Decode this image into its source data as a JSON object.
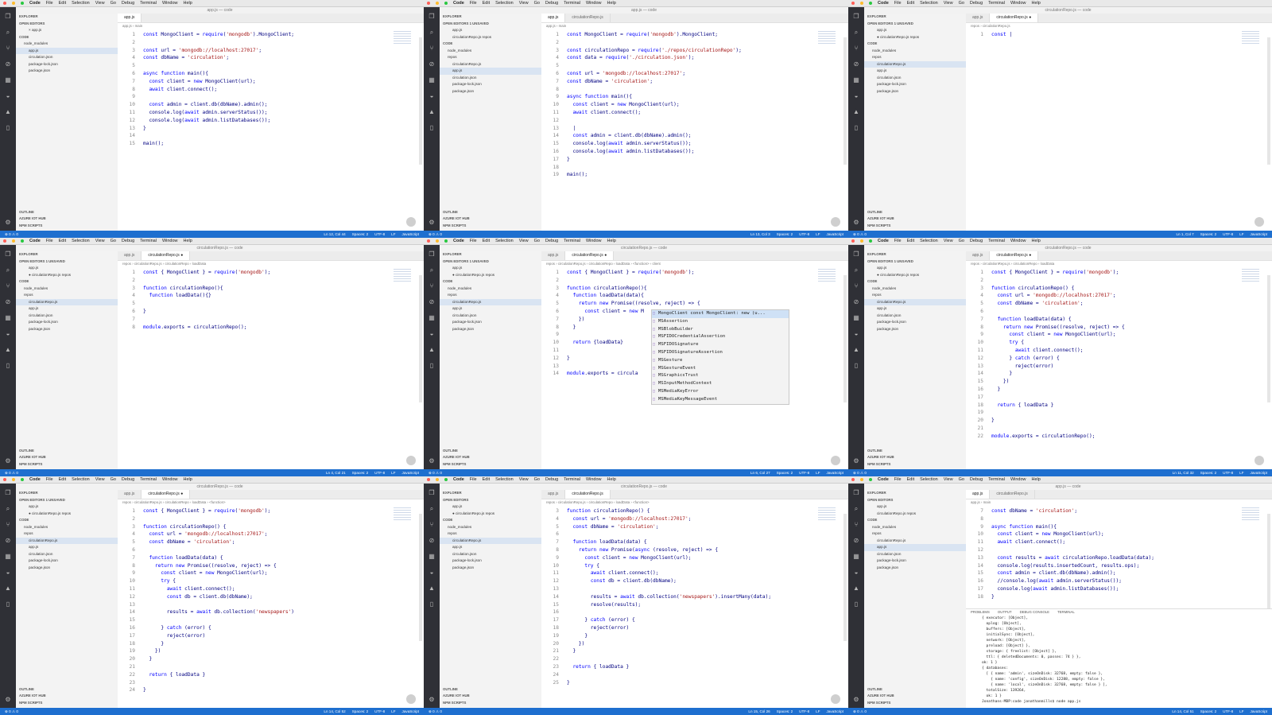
{
  "menubar": {
    "app": "Code",
    "items": [
      "File",
      "Edit",
      "Selection",
      "View",
      "Go",
      "Debug",
      "Terminal",
      "Window",
      "Help"
    ]
  },
  "colors": {
    "status_bar": "#1e6fcf",
    "keyword": "#0000ff",
    "string": "#a31515",
    "sidebar": "#f3f3f3"
  },
  "panels": [
    {
      "title": "app.js — code",
      "sidebar": [
        "EXPLORER",
        "OPEN EDITORS",
        "× app.js",
        "CODE",
        "node_modules",
        "app.js",
        "circulation.json",
        "package-lock.json",
        "package.json"
      ],
      "sidebar_bottom": [
        "OUTLINE",
        "AZURE IOT HUB",
        "NPM SCRIPTS"
      ],
      "tabs": [
        "app.js"
      ],
      "active_tab": 0,
      "breadcrumb": "app.js › main",
      "lines": [
        {
          "n": "1",
          "t": "const MongoClient = require('mongodb').MongoClient;"
        },
        {
          "n": "2",
          "t": ""
        },
        {
          "n": "3",
          "t": "const url = 'mongodb://localhost:27017';"
        },
        {
          "n": "4",
          "t": "const dbName = 'circulation';"
        },
        {
          "n": "5",
          "t": ""
        },
        {
          "n": "6",
          "t": "async function main(){"
        },
        {
          "n": "7",
          "t": "  const client = new MongoClient(url);"
        },
        {
          "n": "8",
          "t": "  await client.connect();"
        },
        {
          "n": "9",
          "t": ""
        },
        {
          "n": "10",
          "t": "  const admin = client.db(dbName).admin();"
        },
        {
          "n": "11",
          "t": "  console.log(await admin.serverStatus());"
        },
        {
          "n": "12",
          "t": "  console.log(await admin.listDatabases());"
        },
        {
          "n": "13",
          "t": "}"
        },
        {
          "n": "14",
          "t": ""
        },
        {
          "n": "15",
          "t": "main();"
        }
      ],
      "status": [
        "Ln 12, Col 44",
        "Spaces: 2",
        "UTF-8",
        "LF",
        "JavaScript"
      ]
    },
    {
      "title": "app.js — code",
      "sidebar": [
        "EXPLORER",
        "OPEN EDITORS  1 UNSAVED",
        "app.js",
        "circulationRepo.js repos",
        "CODE",
        "node_modules",
        "repos",
        "circulationRepo.js",
        "app.js",
        "circulation.json",
        "package-lock.json",
        "package.json"
      ],
      "sidebar_bottom": [
        "OUTLINE",
        "AZURE IOT HUB",
        "NPM SCRIPTS"
      ],
      "tabs": [
        "app.js",
        "circulationRepo.js"
      ],
      "active_tab": 0,
      "breadcrumb": "app.js › main",
      "lines": [
        {
          "n": "1",
          "t": "const MongoClient = require('mongodb').MongoClient;"
        },
        {
          "n": "2",
          "t": ""
        },
        {
          "n": "3",
          "t": "const circulationRepo = require('./repos/circulationRepo');"
        },
        {
          "n": "4",
          "t": "const data = require('./circulation.json');"
        },
        {
          "n": "5",
          "t": ""
        },
        {
          "n": "6",
          "t": "const url = 'mongodb://localhost:27017';"
        },
        {
          "n": "7",
          "t": "const dbName = 'circulation';"
        },
        {
          "n": "8",
          "t": ""
        },
        {
          "n": "9",
          "t": "async function main(){"
        },
        {
          "n": "10",
          "t": "  const client = new MongoClient(url);"
        },
        {
          "n": "11",
          "t": "  await client.connect();"
        },
        {
          "n": "12",
          "t": ""
        },
        {
          "n": "13",
          "t": "  |"
        },
        {
          "n": "14",
          "t": "  const admin = client.db(dbName).admin();"
        },
        {
          "n": "15",
          "t": "  console.log(await admin.serverStatus());"
        },
        {
          "n": "16",
          "t": "  console.log(await admin.listDatabases());"
        },
        {
          "n": "17",
          "t": "}"
        },
        {
          "n": "18",
          "t": ""
        },
        {
          "n": "19",
          "t": "main();"
        }
      ],
      "status": [
        "Ln 13, Col 3",
        "Spaces: 2",
        "UTF-8",
        "LF",
        "JavaScript"
      ]
    },
    {
      "title": "circulationRepo.js — code",
      "sidebar": [
        "EXPLORER",
        "OPEN EDITORS  1 UNSAVED",
        "app.js",
        "● circulationRepo.js repos",
        "CODE",
        "node_modules",
        "repos",
        "circulationRepo.js",
        "app.js",
        "circulation.json",
        "package-lock.json",
        "package.json"
      ],
      "sidebar_bottom": [
        "OUTLINE",
        "AZURE IOT HUB",
        "NPM SCRIPTS"
      ],
      "tabs": [
        "app.js",
        "circulationRepo.js ●"
      ],
      "active_tab": 1,
      "breadcrumb": "repos › circulationRepo.js",
      "lines": [
        {
          "n": "1",
          "t": "const |"
        }
      ],
      "status": [
        "Ln 1, Col 7",
        "Spaces: 2",
        "UTF-8",
        "LF",
        "JavaScript"
      ]
    },
    {
      "title": "circulationRepo.js — code",
      "sidebar": [
        "EXPLORER",
        "OPEN EDITORS  1 UNSAVED",
        "app.js",
        "● circulationRepo.js repos",
        "CODE",
        "node_modules",
        "repos",
        "circulationRepo.js",
        "app.js",
        "circulation.json",
        "package-lock.json",
        "package.json"
      ],
      "sidebar_bottom": [
        "OUTLINE",
        "AZURE IOT HUB",
        "NPM SCRIPTS"
      ],
      "tabs": [
        "app.js",
        "circulationRepo.js ●"
      ],
      "active_tab": 1,
      "breadcrumb": "repos › circulationRepo.js › circulationRepo › loadData",
      "lines": [
        {
          "n": "1",
          "t": "const { MongoClient } = require('mongodb');"
        },
        {
          "n": "2",
          "t": ""
        },
        {
          "n": "3",
          "t": "function circulationRepo(){"
        },
        {
          "n": "4",
          "t": "  function loadData(){}"
        },
        {
          "n": "5",
          "t": ""
        },
        {
          "n": "6",
          "t": "}"
        },
        {
          "n": "7",
          "t": ""
        },
        {
          "n": "8",
          "t": "module.exports = circulationRepo();"
        }
      ],
      "status": [
        "Ln 4, Col 21",
        "Spaces: 2",
        "UTF-8",
        "LF",
        "JavaScript"
      ]
    },
    {
      "title": "circulationRepo.js — code",
      "sidebar": [
        "EXPLORER",
        "OPEN EDITORS  1 UNSAVED",
        "app.js",
        "● circulationRepo.js repos",
        "CODE",
        "node_modules",
        "repos",
        "circulationRepo.js",
        "app.js",
        "circulation.json",
        "package-lock.json",
        "package.json"
      ],
      "sidebar_bottom": [
        "OUTLINE",
        "AZURE IOT HUB",
        "NPM SCRIPTS"
      ],
      "tabs": [
        "app.js",
        "circulationRepo.js ●"
      ],
      "active_tab": 1,
      "breadcrumb": "repos › circulationRepo.js › circulationRepo › loadData › <function> › client",
      "lines": [
        {
          "n": "1",
          "t": "const { MongoClient } = require('mongodb');"
        },
        {
          "n": "2",
          "t": ""
        },
        {
          "n": "3",
          "t": "function circulationRepo(){"
        },
        {
          "n": "4",
          "t": "  function loadData(data){"
        },
        {
          "n": "5",
          "t": "    return new Promise((resolve, reject) => {"
        },
        {
          "n": "6",
          "t": "      const client = new M"
        },
        {
          "n": "7",
          "t": "    })"
        },
        {
          "n": "8",
          "t": "  }"
        },
        {
          "n": "9",
          "t": ""
        },
        {
          "n": "10",
          "t": "  return {loadData}"
        },
        {
          "n": "11",
          "t": ""
        },
        {
          "n": "12",
          "t": "}"
        },
        {
          "n": "13",
          "t": ""
        },
        {
          "n": "14",
          "t": "module.exports = circula"
        }
      ],
      "autocomplete": [
        "MongoClient  const MongoClient: new (u...",
        "MSAssertion",
        "MSBlobBuilder",
        "MSFIDOCredentialAssertion",
        "MSFIDOSignature",
        "MSFIDOSignatureAssertion",
        "MSGesture",
        "MSGestureEvent",
        "MSGraphicsTrust",
        "MSInputMethodContext",
        "MSMediaKeyError",
        "MSMediaKeyMessageEvent"
      ],
      "status": [
        "Ln 6, Col 27",
        "Spaces: 2",
        "UTF-8",
        "LF",
        "JavaScript"
      ]
    },
    {
      "title": "circulationRepo.js — code",
      "sidebar": [
        "EXPLORER",
        "OPEN EDITORS  1 UNSAVED",
        "app.js",
        "● circulationRepo.js repos",
        "CODE",
        "node_modules",
        "repos",
        "circulationRepo.js",
        "app.js",
        "circulation.json",
        "package-lock.json",
        "package.json"
      ],
      "sidebar_bottom": [
        "OUTLINE",
        "AZURE IOT HUB",
        "NPM SCRIPTS"
      ],
      "tabs": [
        "app.js",
        "circulationRepo.js ●"
      ],
      "active_tab": 1,
      "breadcrumb": "repos › circulationRepo.js › circulationRepo › loadData",
      "lines": [
        {
          "n": "1",
          "t": "const { MongoClient } = require('mongodb');"
        },
        {
          "n": "2",
          "t": ""
        },
        {
          "n": "3",
          "t": "function circulationRepo() {"
        },
        {
          "n": "4",
          "t": "  const url = 'mongodb://localhost:27017';"
        },
        {
          "n": "5",
          "t": "  const dbName = 'circulation';"
        },
        {
          "n": "6",
          "t": ""
        },
        {
          "n": "7",
          "t": "  function loadData(data) {"
        },
        {
          "n": "8",
          "t": "    return new Promise((resolve, reject) => {"
        },
        {
          "n": "9",
          "t": "      const client = new MongoClient(url);"
        },
        {
          "n": "10",
          "t": "      try {"
        },
        {
          "n": "11",
          "t": "        await client.connect();"
        },
        {
          "n": "12",
          "t": "      } catch (error) {"
        },
        {
          "n": "13",
          "t": "        reject(error)"
        },
        {
          "n": "14",
          "t": "      }"
        },
        {
          "n": "15",
          "t": "    })"
        },
        {
          "n": "16",
          "t": "  }"
        },
        {
          "n": "17",
          "t": ""
        },
        {
          "n": "18",
          "t": "  return { loadData }"
        },
        {
          "n": "19",
          "t": ""
        },
        {
          "n": "20",
          "t": "}"
        },
        {
          "n": "21",
          "t": ""
        },
        {
          "n": "22",
          "t": "module.exports = circulationRepo();"
        }
      ],
      "status": [
        "Ln 11, Col 32",
        "Spaces: 2",
        "UTF-8",
        "LF",
        "JavaScript"
      ]
    },
    {
      "title": "circulationRepo.js — code",
      "sidebar": [
        "EXPLORER",
        "OPEN EDITORS  1 UNSAVED",
        "app.js",
        "● circulationRepo.js repos",
        "CODE",
        "node_modules",
        "repos",
        "circulationRepo.js",
        "app.js",
        "circulation.json",
        "package-lock.json",
        "package.json"
      ],
      "sidebar_bottom": [
        "OUTLINE",
        "AZURE IOT HUB",
        "NPM SCRIPTS"
      ],
      "tabs": [
        "app.js",
        "circulationRepo.js ●"
      ],
      "active_tab": 1,
      "breadcrumb": "repos › circulationRepo.js › circulationRepo › loadData › <function>",
      "lines": [
        {
          "n": "1",
          "t": "const { MongoClient } = require('mongodb');"
        },
        {
          "n": "2",
          "t": ""
        },
        {
          "n": "3",
          "t": "function circulationRepo() {"
        },
        {
          "n": "4",
          "t": "  const url = 'mongodb://localhost:27017';"
        },
        {
          "n": "5",
          "t": "  const dbName = 'circulation';"
        },
        {
          "n": "6",
          "t": ""
        },
        {
          "n": "7",
          "t": "  function loadData(data) {"
        },
        {
          "n": "8",
          "t": "    return new Promise((resolve, reject) => {"
        },
        {
          "n": "9",
          "t": "      const client = new MongoClient(url);"
        },
        {
          "n": "10",
          "t": "      try {"
        },
        {
          "n": "11",
          "t": "        await client.connect();"
        },
        {
          "n": "12",
          "t": "        const db = client.db(dbName);"
        },
        {
          "n": "13",
          "t": ""
        },
        {
          "n": "14",
          "t": "        results = await db.collection('newspapers')"
        },
        {
          "n": "15",
          "t": ""
        },
        {
          "n": "16",
          "t": "      } catch (error) {"
        },
        {
          "n": "17",
          "t": "        reject(error)"
        },
        {
          "n": "18",
          "t": "      }"
        },
        {
          "n": "19",
          "t": "    })"
        },
        {
          "n": "20",
          "t": "  }"
        },
        {
          "n": "21",
          "t": ""
        },
        {
          "n": "22",
          "t": "  return { loadData }"
        },
        {
          "n": "23",
          "t": ""
        },
        {
          "n": "24",
          "t": "}"
        }
      ],
      "status": [
        "Ln 14, Col 52",
        "Spaces: 2",
        "UTF-8",
        "LF",
        "JavaScript"
      ]
    },
    {
      "title": "circulationRepo.js — code",
      "sidebar": [
        "EXPLORER",
        "OPEN EDITORS",
        "app.js",
        "● circulationRepo.js repos",
        "CODE",
        "node_modules",
        "repos",
        "circulationRepo.js",
        "app.js",
        "circulation.json",
        "package-lock.json",
        "package.json"
      ],
      "sidebar_bottom": [
        "OUTLINE",
        "AZURE IOT HUB",
        "NPM SCRIPTS"
      ],
      "tabs": [
        "app.js",
        "circulationRepo.js"
      ],
      "active_tab": 1,
      "breadcrumb": "repos › circulationRepo.js › circulationRepo › loadData › <function>",
      "lines": [
        {
          "n": "3",
          "t": "function circulationRepo() {"
        },
        {
          "n": "4",
          "t": "  const url = 'mongodb://localhost:27017';"
        },
        {
          "n": "5",
          "t": "  const dbName = 'circulation';"
        },
        {
          "n": "6",
          "t": ""
        },
        {
          "n": "7",
          "t": "  function loadData(data) {"
        },
        {
          "n": "8",
          "t": "    return new Promise(async (resolve, reject) => {"
        },
        {
          "n": "9",
          "t": "      const client = new MongoClient(url);"
        },
        {
          "n": "10",
          "t": "      try {"
        },
        {
          "n": "11",
          "t": "        await client.connect();"
        },
        {
          "n": "12",
          "t": "        const db = client.db(dbName);"
        },
        {
          "n": "13",
          "t": ""
        },
        {
          "n": "14",
          "t": "        results = await db.collection('newspapers').insertMany(data);"
        },
        {
          "n": "15",
          "t": "        resolve(results);"
        },
        {
          "n": "16",
          "t": ""
        },
        {
          "n": "17",
          "t": "      } catch (error) {"
        },
        {
          "n": "18",
          "t": "        reject(error)"
        },
        {
          "n": "19",
          "t": "      }"
        },
        {
          "n": "20",
          "t": "    })"
        },
        {
          "n": "21",
          "t": "  }"
        },
        {
          "n": "22",
          "t": ""
        },
        {
          "n": "23",
          "t": "  return { loadData }"
        },
        {
          "n": "24",
          "t": ""
        },
        {
          "n": "25",
          "t": "}"
        }
      ],
      "status": [
        "Ln 15, Col 26",
        "Spaces: 2",
        "UTF-8",
        "LF",
        "JavaScript"
      ]
    },
    {
      "title": "app.js — code",
      "sidebar": [
        "EXPLORER",
        "OPEN EDITORS",
        "app.js",
        "circulationRepo.js repos",
        "CODE",
        "node_modules",
        "repos",
        "circulationRepo.js",
        "app.js",
        "circulation.json",
        "package-lock.json",
        "package.json"
      ],
      "sidebar_bottom": [
        "OUTLINE",
        "AZURE IOT HUB",
        "NPM SCRIPTS"
      ],
      "tabs": [
        "app.js",
        "circulationRepo.js"
      ],
      "active_tab": 0,
      "breadcrumb": "app.js › main",
      "lines": [
        {
          "n": "7",
          "t": "const dbName = 'circulation';"
        },
        {
          "n": "8",
          "t": ""
        },
        {
          "n": "9",
          "t": "async function main(){"
        },
        {
          "n": "10",
          "t": "  const client = new MongoClient(url);"
        },
        {
          "n": "11",
          "t": "  await client.connect();"
        },
        {
          "n": "12",
          "t": ""
        },
        {
          "n": "13",
          "t": "  const results = await circulationRepo.loadData(data);"
        },
        {
          "n": "14",
          "t": "  console.log(results.insertedCount, results.ops);"
        },
        {
          "n": "15",
          "t": "  const admin = client.db(dbName).admin();"
        },
        {
          "n": "16",
          "t": "  //console.log(await admin.serverStatus());"
        },
        {
          "n": "17",
          "t": "  console.log(await admin.listDatabases());"
        },
        {
          "n": "18",
          "t": "}"
        }
      ],
      "panel_tabs": [
        "PROBLEMS",
        "OUTPUT",
        "DEBUG CONSOLE",
        "TERMINAL"
      ],
      "terminal": [
        "{ executor: [Object],",
        "  oplog: [Object],",
        "  buffers: [Object],",
        "  initialSync: [Object],",
        "  network: [Object],",
        "  preload: [Object] },",
        "  storage: { freelist: [Object] },",
        "  ttl: { deletedDocuments: 0, passes: 74 } },",
        "ok: 1 }",
        "{ databases:",
        "  [ { name: 'admin', sizeOnDisk: 32768, empty: false },",
        "    { name: 'config', sizeOnDisk: 12288, empty: false },",
        "    { name: 'local', sizeOnDisk: 32768, empty: false } ],",
        "  totalSize: 139264,",
        "  ok: 1 }",
        "Jonathans-MBP:code jonathanmills$ node app.js"
      ],
      "status": [
        "Ln 14, Col 51",
        "Spaces: 2",
        "UTF-8",
        "LF",
        "JavaScript"
      ]
    }
  ]
}
